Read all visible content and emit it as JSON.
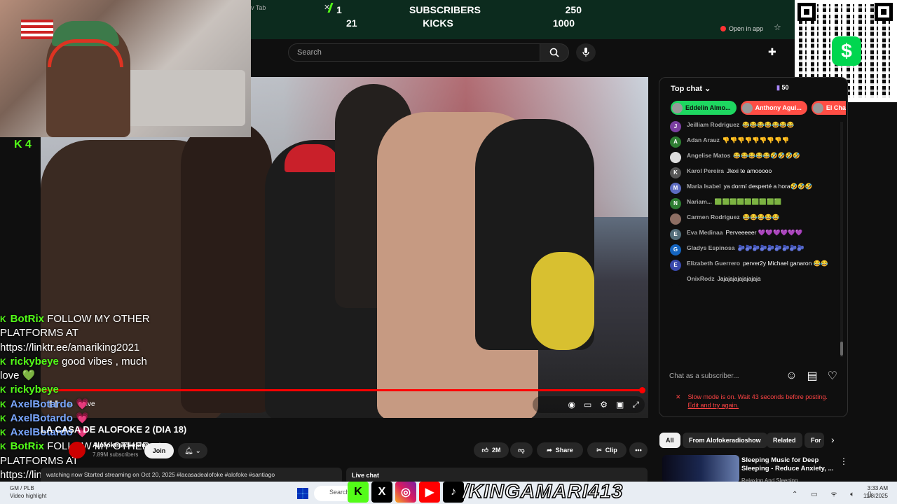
{
  "stream_overlay": {
    "tab_label": "v Tab",
    "rows": [
      {
        "current": "1",
        "label": "SUBSCRIBERS",
        "goal": "250"
      },
      {
        "current": "21",
        "label": "KICKS",
        "goal": "1000"
      }
    ],
    "kick_count": "4"
  },
  "header": {
    "open_in_app": "Open in app",
    "search_placeholder": "Search"
  },
  "video": {
    "live_label": "Live",
    "progress": 1.0,
    "title": "LA CASA DE ALOFOKE 2 (DIA 18)",
    "channel": "Alofokeradioshow",
    "subscribers": "7.89M subscribers",
    "join_label": "Join",
    "likes": "2M",
    "share_label": "Share",
    "clip_label": "Clip",
    "description": "watching now  Started streaming on Oct 20, 2025  #lacasadealofoke #alofoke #santiago",
    "live_chat_bar": "Live chat"
  },
  "chat": {
    "header": "Top chat",
    "viewer_count": "50",
    "pinned": [
      {
        "name": "Eddelin Almo...",
        "color": "#1ed760"
      },
      {
        "name": "Anthony Agui...",
        "color": "#ff4e45"
      },
      {
        "name": "El Chav",
        "color": "#ff4e45"
      }
    ],
    "messages": [
      {
        "initial": "J",
        "avatar_color": "#7b3fa0",
        "author": "Jeilliam Rodriguez",
        "text": "😂😂😂😂😂😂😂"
      },
      {
        "initial": "A",
        "avatar_color": "#2e7d32",
        "author": "Adan Arauz",
        "text": "👎👎👎👎👎👎👎👎👎"
      },
      {
        "initial": "",
        "avatar_color": "#dddddd",
        "author": "Angelise Matos",
        "text": "😂😂😂😂😂🤣🤣🤣🤣"
      },
      {
        "initial": "K",
        "avatar_color": "#555555",
        "author": "Karol Pereira",
        "text": "Jlexi te amooooo"
      },
      {
        "initial": "M",
        "avatar_color": "#5c6bc0",
        "author": "Maria Isabel",
        "text": "ya dormí desperté a hora🤣🤣🤣"
      },
      {
        "initial": "N",
        "avatar_color": "#2e7d32",
        "author": "Nariam...",
        "text": "🟩🟩🟩🟩🟩🟩🟩🟩🟩"
      },
      {
        "initial": "",
        "avatar_color": "#8d6e63",
        "author": "Carmen Rodriguez",
        "text": "😂😂😂😂😂"
      },
      {
        "initial": "E",
        "avatar_color": "#546e7a",
        "author": "Eva Medinaa",
        "text": "Perveeeeer 💜💜💜💜💜💜"
      },
      {
        "initial": "G",
        "avatar_color": "#1565c0",
        "author": "Gladys Espinosa",
        "text": "🫐🫐🫐🫐🫐🫐🫐🫐🫐"
      },
      {
        "initial": "E",
        "avatar_color": "#3949ab",
        "author": "Elizabeth Guerrero",
        "text": "perver2y Michael ganaron 😂😂"
      },
      {
        "initial": "",
        "avatar_color": "#0f0f0f",
        "author": "OnixRodz",
        "text": "Jajajajajajajajaja"
      }
    ],
    "input_placeholder": "Chat as a subscriber...",
    "slow_mode_text": "Slow mode is on. Wait 43 seconds before posting.",
    "slow_mode_link": "Edit and try again."
  },
  "overlay_chat": [
    {
      "name": "BotRix",
      "name_color": "#53fc18",
      "text": "FOLLOW MY OTHER PLATFORMS AT https://linktr.ee/amariking2021"
    },
    {
      "name": "rickybeye",
      "name_color": "#53fc18",
      "text": "good vibes , much love 💚"
    },
    {
      "name": "rickybeye",
      "name_color": "#53fc18",
      "text": ""
    },
    {
      "name": "AxelBotardo",
      "name_color": "#7aa7ff",
      "text": "💗"
    },
    {
      "name": "AxelBotardo",
      "name_color": "#7aa7ff",
      "text": "💗"
    },
    {
      "name": "AxelBotardo",
      "name_color": "#7aa7ff",
      "text": "💗"
    },
    {
      "name": "BotRix",
      "name_color": "#53fc18",
      "text": "FOLLOW MY OTHER PLATFORMS AT https://linktr.ee/amariking2021"
    }
  ],
  "recommend": {
    "chips": [
      "All",
      "From Alofokeradioshow",
      "Related",
      "For"
    ],
    "title": "Sleeping Music for Deep Sleeping - Reduce Anxiety, ...",
    "subtitle": "Relaxing And Sleeping"
  },
  "taskbar": {
    "left_label": "GM / PLB\nVideo highlight",
    "search_label": "Search",
    "kick_handle": "/KINGAMARI413",
    "time": "3:33 AM",
    "date": "11/8/2025"
  },
  "colors": {
    "kick_green": "#53fc18",
    "yt_red": "#ff0000",
    "cashapp": "#00d64f"
  }
}
